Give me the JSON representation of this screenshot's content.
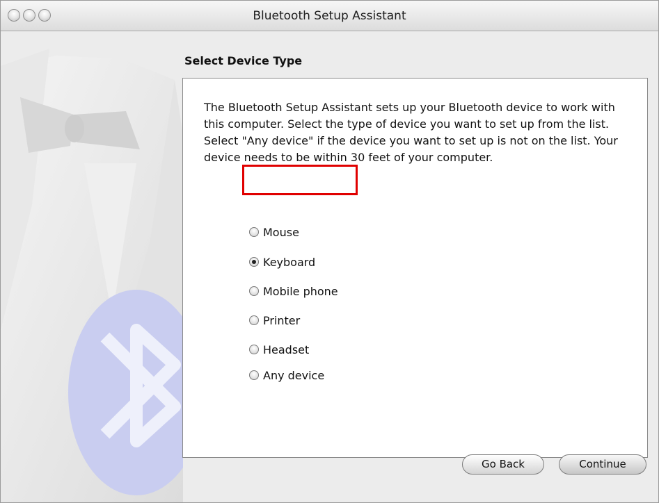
{
  "window": {
    "title": "Bluetooth Setup Assistant"
  },
  "page": {
    "section_title": "Select Device Type",
    "description": "The Bluetooth Setup Assistant sets up your Bluetooth device to work with this computer. Select the type of device you want to set up from the list. Select \"Any device\" if the device you want to set up is not on the list. Your device needs to be within 30 feet of your computer.",
    "options": [
      {
        "label": "Mouse",
        "selected": false
      },
      {
        "label": "Keyboard",
        "selected": true
      },
      {
        "label": "Mobile phone",
        "selected": false
      },
      {
        "label": "Printer",
        "selected": false
      },
      {
        "label": "Headset",
        "selected": false
      },
      {
        "label": "Any device",
        "selected": false
      }
    ],
    "annotation_color": "#e00000"
  },
  "buttons": {
    "back": "Go Back",
    "continue": "Continue"
  }
}
